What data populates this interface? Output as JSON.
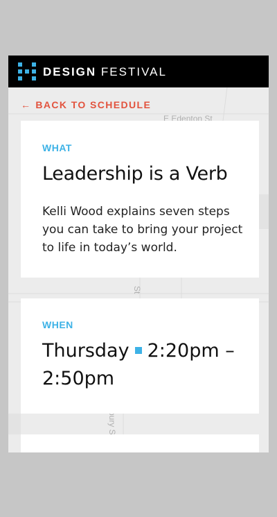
{
  "header": {
    "brand_bold": "DESIGN",
    "brand_light": "FESTIVAL"
  },
  "nav": {
    "back_label": "BACK TO SCHEDULE",
    "back_icon": "arrow-left-icon"
  },
  "map": {
    "street_1": "E Edenton St",
    "street_2": "St",
    "street_3": "bury S"
  },
  "what": {
    "label": "WHAT",
    "title": "Leadership is a Verb",
    "description": "Kelli Wood explains seven steps you can take to bring your project to life in today’s world."
  },
  "when": {
    "label": "WHEN",
    "day": "Thursday",
    "time_start": "2:20pm",
    "time_end": "2:50pm"
  },
  "colors": {
    "accent_blue": "#3db2e6",
    "accent_red": "#e2533e",
    "header_bg": "#000000"
  }
}
